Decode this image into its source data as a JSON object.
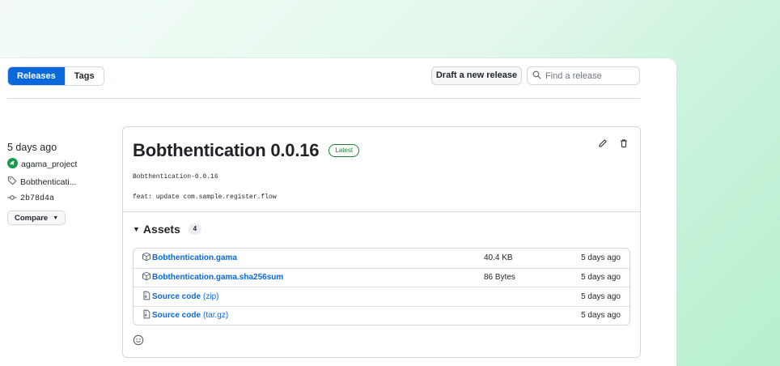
{
  "tabs": [
    {
      "label": "Releases",
      "active": true
    },
    {
      "label": "Tags",
      "active": false
    }
  ],
  "toolbar": {
    "draft_label": "Draft a new release",
    "search_placeholder": "Find a release"
  },
  "sidebar": {
    "time_ago": "5 days ago",
    "author": "agama_project",
    "tag": "Bobthenticati...",
    "commit": "2b78d4a",
    "compare_label": "Compare"
  },
  "release": {
    "title": "Bobthentication 0.0.16",
    "badge": "Latest",
    "tag_line": "Bobthentication-0.0.16",
    "commit_message": "feat: update com.sample.register.flow"
  },
  "assets": {
    "heading": "Assets",
    "count": "4",
    "rows": [
      {
        "name": "Bobthentication.gama",
        "suffix": "",
        "size": "40.4 KB",
        "date": "5 days ago",
        "icon": "package-icon"
      },
      {
        "name": "Bobthentication.gama.sha256sum",
        "suffix": "",
        "size": "86 Bytes",
        "date": "5 days ago",
        "icon": "package-icon"
      },
      {
        "name": "Source code",
        "suffix": "(zip)",
        "size": "",
        "date": "5 days ago",
        "icon": "file-zip-icon"
      },
      {
        "name": "Source code",
        "suffix": "(tar.gz)",
        "size": "",
        "date": "5 days ago",
        "icon": "file-zip-icon"
      }
    ]
  },
  "colors": {
    "accent": "#0969da",
    "success": "#1a7f37",
    "border": "#d0d7de"
  }
}
